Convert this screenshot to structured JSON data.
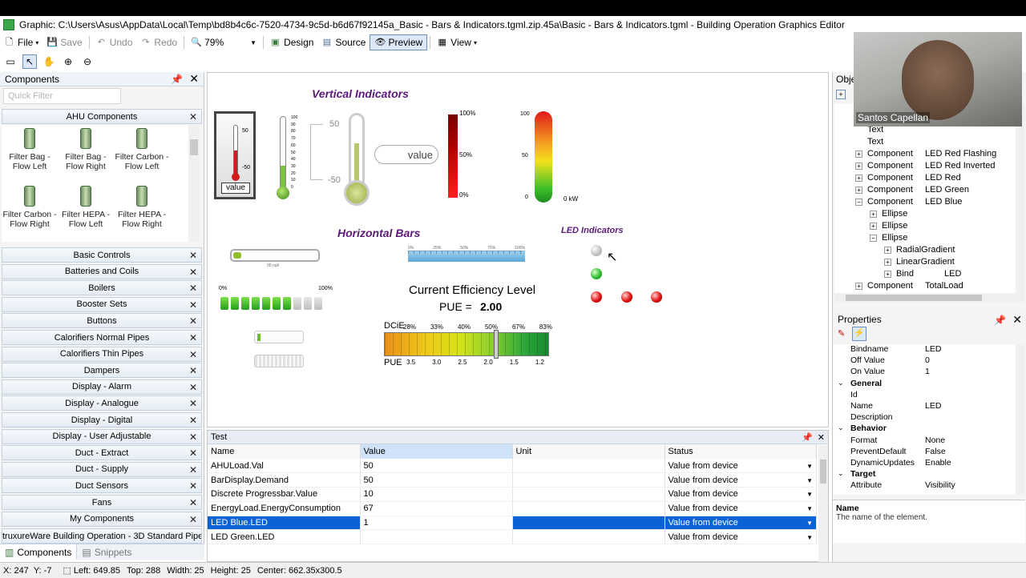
{
  "window": {
    "title": "Graphic: C:\\Users\\Asus\\AppData\\Local\\Temp\\bd8b4c6c-7520-4734-9c5d-b6d67f92145a_Basic - Bars & Indicators.tgml.zip.45a\\Basic - Bars & Indicators.tgml - Building Operation Graphics Editor"
  },
  "toolbar": {
    "file": "File",
    "save": "Save",
    "undo": "Undo",
    "redo": "Redo",
    "zoom": "79%",
    "design": "Design",
    "source": "Source",
    "preview": "Preview",
    "view": "View"
  },
  "left": {
    "title": "Components",
    "filter_placeholder": "Quick Filter",
    "open_group": "AHU Components",
    "components": [
      "Filter Bag - Flow Left",
      "Filter Bag - Flow Right",
      "Filter Carbon - Flow Left",
      "Filter Carbon - Flow Right",
      "Filter HEPA - Flow Left",
      "Filter HEPA - Flow Right"
    ],
    "groups": [
      "Basic Controls",
      "Batteries and Coils",
      "Boilers",
      "Booster Sets",
      "Buttons",
      "Calorifiers Normal Pipes",
      "Calorifiers Thin Pipes",
      "Dampers",
      "Display - Alarm",
      "Display - Analogue",
      "Display - Digital",
      "Display - User Adjustable",
      "Duct - Extract",
      "Duct - Supply",
      "Duct Sensors",
      "Fans",
      "My Components"
    ],
    "cut_group": "truxureWare Building Operation - 3D Standard Pipes 'Phi",
    "tabs": [
      "Components",
      "Snippets"
    ]
  },
  "canvas": {
    "vertical_title": "Vertical Indicators",
    "horizontal_title": "Horizontal Bars",
    "led_title": "LED Indicators",
    "thermo1_top": "50",
    "thermo1_bottom": "-50",
    "thermo1_value": "value",
    "thermo2_ticks": [
      "100",
      "90",
      "80",
      "70",
      "60",
      "50",
      "40",
      "30",
      "20",
      "10",
      "0"
    ],
    "thermo3_top": "50",
    "thermo3_bottom": "-50",
    "value_box": "value",
    "bar_ticks": [
      "100%",
      "50%",
      "0%"
    ],
    "gauge_ticks": [
      "100",
      "50",
      "0"
    ],
    "gauge_unit": "0 kW",
    "hbar1_label": "00 null",
    "ruler_ticks": [
      "0%",
      "25%",
      "50%",
      "75%",
      "100%"
    ],
    "discrete_start": "0%",
    "discrete_end": "100%",
    "discrete_filled": 7,
    "discrete_total": 10,
    "efficiency_title": "Current Efficiency Level",
    "pue_label": "PUE =",
    "pue_value": "2.00",
    "dcie_label": "DCiE",
    "dcie_ticks": [
      "28%",
      "33%",
      "40%",
      "50%",
      "67%",
      "83%"
    ],
    "pue_axis_label": "PUE",
    "pue_ticks": [
      "3.5",
      "3.0",
      "2.5",
      "2.0",
      "1.5",
      "1.2"
    ],
    "colors": {
      "title_purple": "#5a1a78",
      "led_green": "#2fbf2f",
      "led_red": "#e01010",
      "led_off": "#cfcfcf"
    }
  },
  "test": {
    "title": "Test",
    "columns": [
      "Name",
      "Value",
      "Unit",
      "Status"
    ],
    "rows": [
      {
        "name": "AHULoad.Val",
        "value": "50",
        "unit": "",
        "status": "Value from device"
      },
      {
        "name": "BarDisplay.Demand",
        "value": "50",
        "unit": "",
        "status": "Value from device"
      },
      {
        "name": "Discrete Progressbar.Value",
        "value": "10",
        "unit": "",
        "status": "Value from device"
      },
      {
        "name": "EnergyLoad.EnergyConsumption",
        "value": "67",
        "unit": "",
        "status": "Value from device"
      },
      {
        "name": "LED Blue.LED",
        "value": "1",
        "unit": "",
        "status": "Value from device"
      },
      {
        "name": "LED Green.LED",
        "value": "",
        "unit": "",
        "status": "Value from device"
      }
    ]
  },
  "objects": {
    "title": "Obje",
    "rows": [
      {
        "a": "Component",
        "b": "LinearProgressBar"
      },
      {
        "a": "Text",
        "b": ""
      },
      {
        "a": "Text",
        "b": ""
      },
      {
        "a": "Text",
        "b": ""
      },
      {
        "a": "Component",
        "b": "LED Red Flashing"
      },
      {
        "a": "Component",
        "b": "LED Red Inverted"
      },
      {
        "a": "Component",
        "b": "LED Red"
      },
      {
        "a": "Component",
        "b": "LED Green"
      },
      {
        "a": "Component",
        "b": "LED Blue"
      },
      {
        "a": "Ellipse",
        "b": ""
      },
      {
        "a": "Ellipse",
        "b": ""
      },
      {
        "a": "Ellipse",
        "b": ""
      },
      {
        "a": "RadialGradient",
        "b": ""
      },
      {
        "a": "LinearGradient",
        "b": ""
      },
      {
        "a": "Bind",
        "b": "LED"
      },
      {
        "a": "Component",
        "b": "TotalLoad"
      }
    ]
  },
  "properties": {
    "title": "Properties",
    "items": [
      {
        "k": "Bindname",
        "v": "LED"
      },
      {
        "k": "Off Value",
        "v": "0"
      },
      {
        "k": "On Value",
        "v": "1"
      },
      {
        "k": "General",
        "v": ""
      },
      {
        "k": "Id",
        "v": ""
      },
      {
        "k": "Name",
        "v": "LED"
      },
      {
        "k": "Description",
        "v": ""
      },
      {
        "k": "Behavior",
        "v": ""
      },
      {
        "k": "Format",
        "v": "None"
      },
      {
        "k": "PreventDefault",
        "v": "False"
      },
      {
        "k": "DynamicUpdates",
        "v": "Enable"
      },
      {
        "k": "Target",
        "v": ""
      },
      {
        "k": "Attribute",
        "v": "Visibility"
      }
    ],
    "help_title": "Name",
    "help_text": "The name of the element."
  },
  "status": {
    "x": "X: 247",
    "y": "Y: -7",
    "left": "Left: 649.85",
    "top": "Top: 288",
    "width": "Width: 25",
    "height": "Height: 25",
    "center": "Center: 662.35x300.5"
  },
  "webcam": {
    "name": "Santos Capellan"
  }
}
